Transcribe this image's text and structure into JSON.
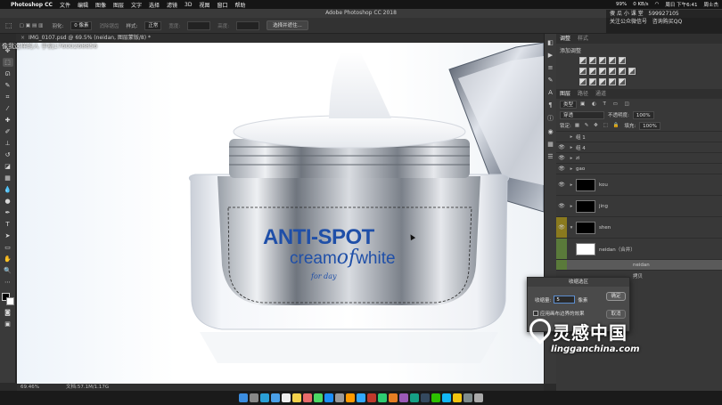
{
  "menubar": {
    "app": "Photoshop CC",
    "items": [
      "文件",
      "编辑",
      "图像",
      "图层",
      "文字",
      "选择",
      "滤镜",
      "3D",
      "视图",
      "窗口",
      "帮助"
    ],
    "battery": "99%",
    "speed": "0 KB/s",
    "datetime": "周日 下午6:41",
    "user": "周士杰"
  },
  "titlebar": {
    "title": "Adobe Photoshop CC 2018"
  },
  "options": {
    "feather_label": "羽化:",
    "feather_value": "0 像素",
    "antialias": "消除锯齿",
    "style_label": "样式:",
    "style_value": "正常",
    "width_label": "宽度:",
    "height_label": "高度:",
    "select_mask_button": "选择并遮住..."
  },
  "document": {
    "tab": "IMG_0107.psd @ 69.5% (neidan, 图层蒙版/8) *",
    "zoom": "69.46%",
    "doc_size": "文档:57.1M/1.17G"
  },
  "watermarks": {
    "top_left": "像我这样的人 手机17600268856",
    "top_right_name": "傻 瓜 小 课 堂",
    "top_right_qq": "599927105",
    "top_right_sub": "关注公众微信号",
    "top_right_qq_label": "咨询购买QQ",
    "brand_cn": "灵感中国",
    "brand_en": "lingganchina.com"
  },
  "product": {
    "line1": "ANTI-SPOT",
    "line2a": "cream",
    "line2b": "of",
    "line2c": "white",
    "line3": "for day"
  },
  "panels": {
    "tabs": [
      "调整",
      "样式"
    ],
    "adjust_title": "添加调整",
    "layers_tabs": [
      "图层",
      "路径",
      "通道"
    ],
    "kind_label": "类型",
    "blend_mode": "穿透",
    "opacity_label": "不透明度:",
    "opacity_value": "100%",
    "lock_label": "锁定:",
    "fill_label": "填充:",
    "fill_value": "100%",
    "layers": [
      {
        "name": "组 1"
      },
      {
        "name": "组 4"
      },
      {
        "name": "zi"
      },
      {
        "name": "gao"
      },
      {
        "name": "kou"
      },
      {
        "name": "jing"
      },
      {
        "name": "shen"
      },
      {
        "name": "neidan（合并）"
      },
      {
        "name": "neidan"
      },
      {
        "name": "拷贝"
      }
    ]
  },
  "dialog": {
    "title": "收缩选区",
    "amount_label": "收缩量:",
    "amount_value": "5",
    "unit": "像素",
    "ok": "确定",
    "cancel": "取消",
    "canvas_bounds": "应用画布边界的效果"
  },
  "colors": {
    "brand_blue": "#1f4fa8",
    "selection": "#5a5a5a",
    "canvas_bg": "#eef4fa"
  }
}
